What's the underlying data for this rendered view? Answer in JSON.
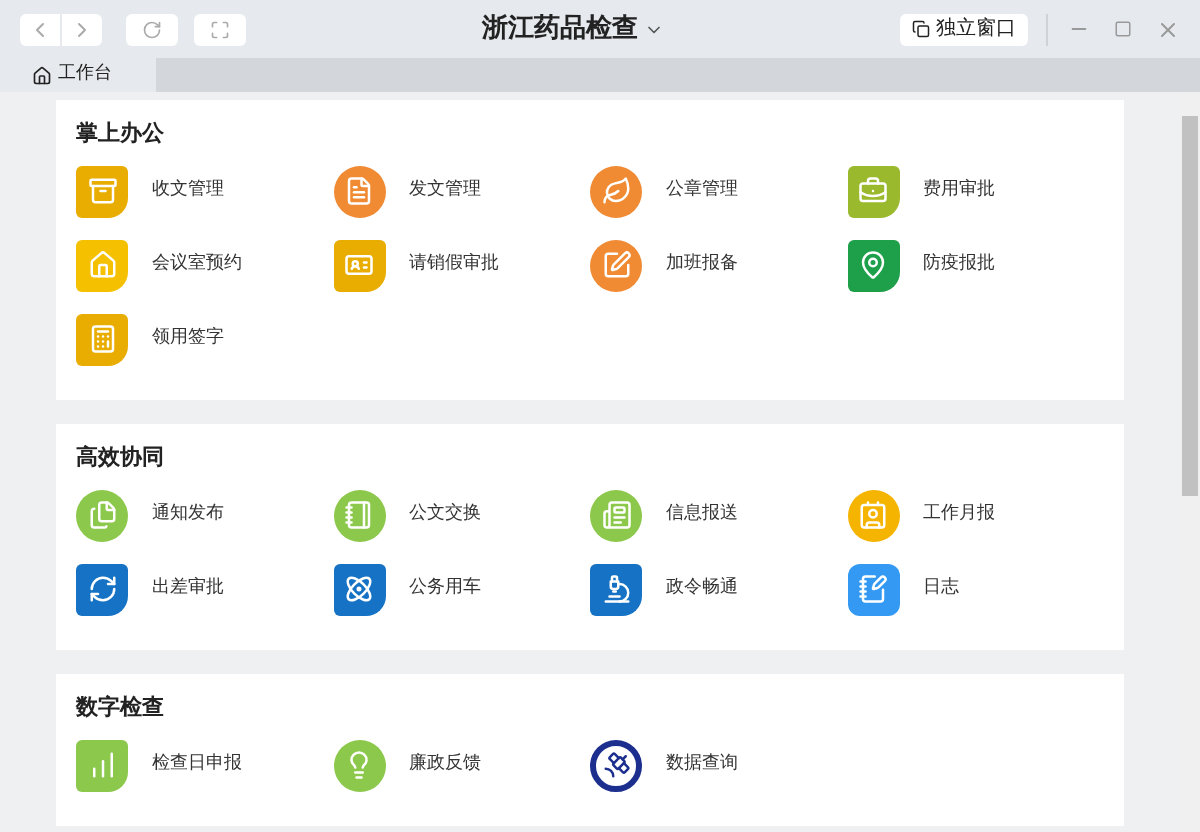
{
  "window": {
    "title": "浙江药品检查",
    "detach_button": "独立窗口"
  },
  "tabs": [
    {
      "label": "工作台",
      "selected": true
    }
  ],
  "sections": [
    {
      "title": "掌上办公",
      "items": [
        {
          "label": "收文管理",
          "kind": "leaf",
          "color": "#e8ad00"
        },
        {
          "label": "发文管理",
          "kind": "circle",
          "color": "#f08a33"
        },
        {
          "label": "公章管理",
          "kind": "circle",
          "color": "#f08a33"
        },
        {
          "label": "费用审批",
          "kind": "leaf",
          "color": "#9ab92c"
        },
        {
          "label": "会议室预约",
          "kind": "leaf",
          "color": "#f5c000"
        },
        {
          "label": "请销假审批",
          "kind": "leaf",
          "color": "#e8ad00"
        },
        {
          "label": "加班报备",
          "kind": "circle",
          "color": "#f08a33"
        },
        {
          "label": "防疫报批",
          "kind": "leaf",
          "color": "#1ea04a"
        },
        {
          "label": "领用签字",
          "kind": "leaf",
          "color": "#e8ad00"
        }
      ]
    },
    {
      "title": "高效协同",
      "items": [
        {
          "label": "通知发布",
          "kind": "circle",
          "color": "#8cc84b"
        },
        {
          "label": "公文交换",
          "kind": "circle",
          "color": "#8cc84b"
        },
        {
          "label": "信息报送",
          "kind": "circle",
          "color": "#8cc84b"
        },
        {
          "label": "工作月报",
          "kind": "circle",
          "color": "#f5b400"
        },
        {
          "label": "出差审批",
          "kind": "leaf",
          "color": "#1672c4"
        },
        {
          "label": "公务用车",
          "kind": "leaf",
          "color": "#1672c4"
        },
        {
          "label": "政令畅通",
          "kind": "leaf",
          "color": "#1672c4"
        },
        {
          "label": "日志",
          "kind": "rounded",
          "color": "#3399f3"
        }
      ]
    },
    {
      "title": "数字检查",
      "items": [
        {
          "label": "检查日申报",
          "kind": "leaf",
          "color": "#8cc84b"
        },
        {
          "label": "廉政反馈",
          "kind": "circle",
          "color": "#8cc84b"
        },
        {
          "label": "数据查询",
          "kind": "ring",
          "color": "#1c2f8f"
        }
      ]
    }
  ]
}
